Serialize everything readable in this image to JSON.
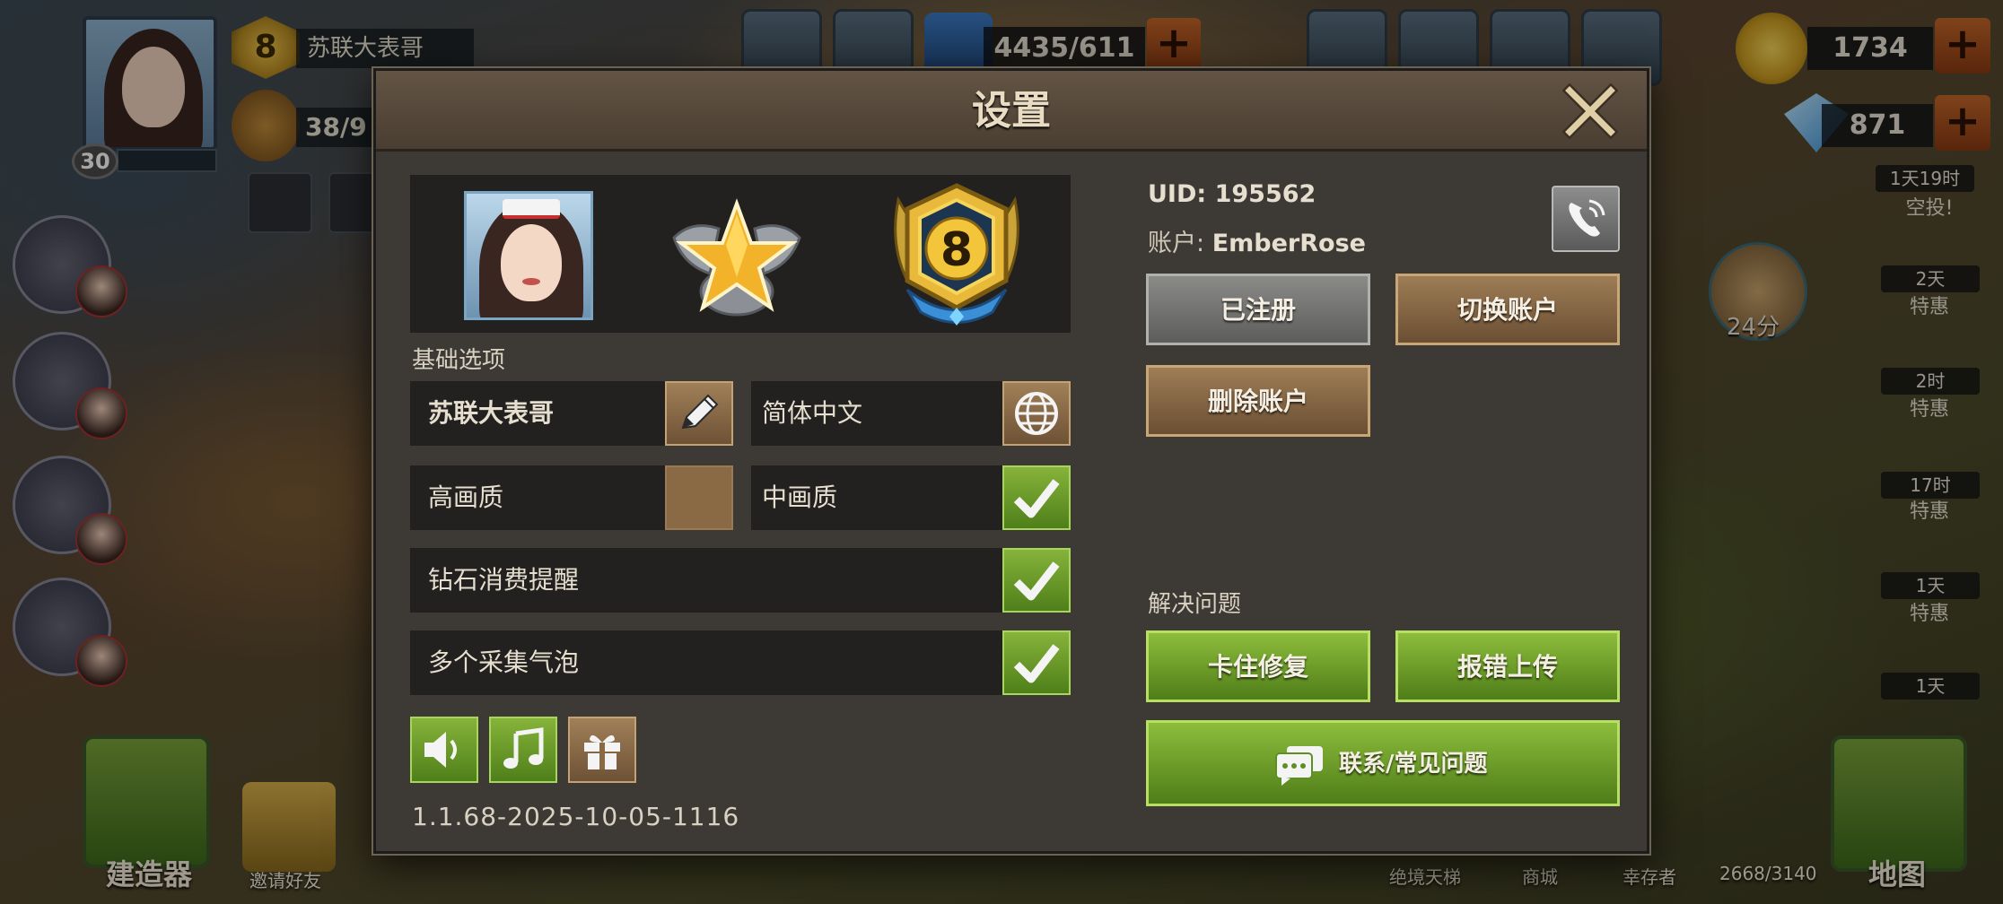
{
  "hud": {
    "player_name": "苏联大表哥",
    "player_level": "30",
    "rank_number": "8",
    "population": "38/9",
    "energy": "4435/611",
    "gold": "1734",
    "diamonds": "871",
    "offers": [
      {
        "label": "空投!",
        "timer": "1天19时"
      },
      {
        "label": "特惠",
        "timer": "2天"
      },
      {
        "label": "特惠",
        "timer": "2时"
      },
      {
        "label": "特惠",
        "timer": "17时"
      },
      {
        "label": "特惠",
        "timer": "1天"
      },
      {
        "label": "特惠",
        "timer": "1天"
      }
    ],
    "food_timer": "24分",
    "bottom": {
      "builder": "建造器",
      "invite": "邀请好友",
      "ladder": "绝境天梯",
      "shop": "商城",
      "survivors": "幸存者",
      "capacity": "2668/3140",
      "map": "地图"
    }
  },
  "dialog": {
    "title": "设置",
    "close_icon": "close-x-icon",
    "profile": {
      "rank_number": "8"
    },
    "basic_options_label": "基础选项",
    "options": {
      "player_name": "苏联大表哥",
      "language": "简体中文",
      "high_quality": "高画质",
      "medium_quality": "中画质",
      "diamond_reminder": "钻石消费提醒",
      "multi_bubble": "多个采集气泡"
    },
    "toggles": {
      "high_quality_checked": false,
      "medium_quality_checked": true,
      "diamond_reminder_checked": true,
      "multi_bubble_checked": true
    },
    "version": "1.1.68-2025-10-05-1116",
    "account": {
      "uid_label": "UID:",
      "uid_value": "195562",
      "account_label": "账户:",
      "account_value": "EmberRose",
      "registered": "已注册",
      "switch_account": "切换账户",
      "delete_account": "删除账户"
    },
    "troubleshoot_label": "解决问题",
    "stuck_fix": "卡住修复",
    "report_upload": "报错上传",
    "contact_faq": "联系/常见问题"
  },
  "colors": {
    "accent_green": "#86b33a",
    "accent_brown": "#9e7d56",
    "panel_bg": "#3d3a36",
    "header_bg": "#635444"
  }
}
